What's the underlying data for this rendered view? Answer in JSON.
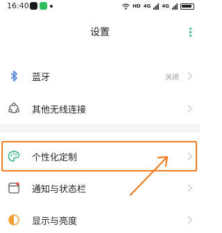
{
  "status_bar": {
    "time": "16:40",
    "network": "HD",
    "signal1": "4G",
    "signal2": "4G",
    "battery": "100"
  },
  "header": {
    "title": "设置"
  },
  "settings": {
    "items": [
      {
        "label": "蓝牙",
        "value": "关闭",
        "icon": "bluetooth-icon"
      },
      {
        "label": "其他无线连接",
        "value": "",
        "icon": "wireless-icon"
      },
      {
        "label": "个性化定制",
        "value": "",
        "icon": "palette-icon"
      },
      {
        "label": "通知与状态栏",
        "value": "",
        "icon": "notification-icon"
      },
      {
        "label": "显示与亮度",
        "value": "",
        "icon": "brightness-icon"
      }
    ]
  },
  "colors": {
    "accent": "#2bb07f",
    "highlight": "#f07a1e"
  }
}
